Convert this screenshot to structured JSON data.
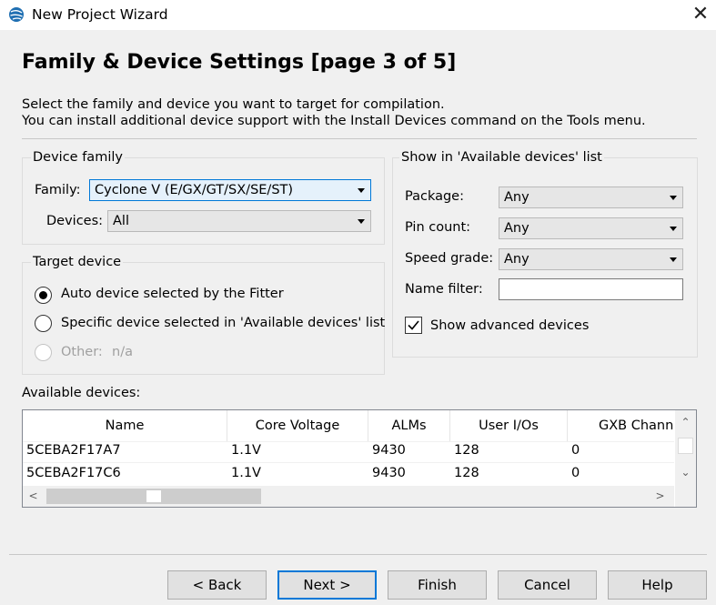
{
  "window": {
    "title": "New Project Wizard",
    "close_glyph": "✕"
  },
  "page": {
    "heading": "Family & Device Settings [page 3 of 5]",
    "description_line1": "Select the family and device you want to target for compilation.",
    "description_line2": "You can install additional device support with the Install Devices command on the Tools menu."
  },
  "device_family": {
    "group_title": "Device family",
    "family_label": "Family:",
    "family_value": "Cyclone V (E/GX/GT/SX/SE/ST)",
    "devices_label": "Devices:",
    "devices_value": "All"
  },
  "target_device": {
    "group_title": "Target device",
    "auto_label": "Auto device selected by the Fitter",
    "specific_label": "Specific device selected in 'Available devices' list",
    "other_label": "Other:",
    "other_value": "n/a",
    "selected": "auto"
  },
  "filters": {
    "group_title": "Show in 'Available devices' list",
    "package_label": "Package:",
    "package_value": "Any",
    "pin_count_label": "Pin count:",
    "pin_count_value": "Any",
    "speed_grade_label": "Speed grade:",
    "speed_grade_value": "Any",
    "name_filter_label": "Name filter:",
    "name_filter_value": "",
    "show_advanced_label": "Show advanced devices",
    "show_advanced_checked": true
  },
  "available_devices": {
    "label": "Available devices:",
    "columns": [
      "Name",
      "Core Voltage",
      "ALMs",
      "User I/Os",
      "GXB Channe"
    ],
    "rows": [
      [
        "5CEBA2F17A7",
        "1.1V",
        "9430",
        "128",
        "0"
      ],
      [
        "5CEBA2F17C6",
        "1.1V",
        "9430",
        "128",
        "0"
      ]
    ]
  },
  "buttons": {
    "back": "< Back",
    "next": "Next >",
    "finish": "Finish",
    "cancel": "Cancel",
    "help": "Help"
  },
  "colors": {
    "accent": "#0078d7",
    "dialog_bg": "#f0f0f0",
    "combo_bg": "#e6e6e6"
  }
}
